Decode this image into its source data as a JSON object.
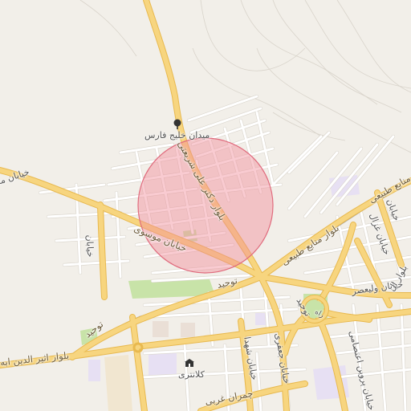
{
  "map": {
    "highlight_circle": {
      "fill": "#f28b9a",
      "stroke": "#e06c7e",
      "opacity": 0.45
    },
    "colors": {
      "background": "#f2efe9",
      "major_road": "#f7d57f",
      "major_road_casing": "#e8b94f",
      "minor_road": "#ffffff",
      "minor_road_casing": "#d9d4cb",
      "park": "#c8e3a8",
      "water": "#aad3df",
      "building_area": "#e7e0f3",
      "sand": "#f1e6d0"
    },
    "labels": {
      "square_khalij_fars": "میدان خلیج فارس",
      "blvd_doctor_ali_shariati": "بلوار دکتر علی شریعتی",
      "street_musavi": "خیابان موسوی",
      "street_west_edge": "خیابان مه",
      "blvd_manabe_tabiei_upper": "بلوار منابع طبیعی",
      "blvd_manabe_tabiei_lower": "بلوار منابع طبیعی",
      "street_vali_asr": "خیابان ولیعصر",
      "tohid_1": "توحید",
      "tohid_2": "توحید",
      "tohid_3": "توحید",
      "blvd_atir_aldin": "بلوار اثیر الدین ابه",
      "street_jafari": "خیابان جعفری",
      "street_shohada": "خیابان شهدا",
      "street_parvin_etesami": "خیابان پروین اعتصامی",
      "street_ghazal": "خیابان غزال",
      "street_left_vertical": "خیابان",
      "street_right_upper": "خیابان",
      "kalantari": "کلانتری",
      "chamran": "چمران غربی",
      "blvd_right_edge": "بلوار ال",
      "rah_ahan": "راه"
    },
    "icons": {
      "square_icon": "tree-icon",
      "police_icon": "police-station-icon"
    }
  }
}
